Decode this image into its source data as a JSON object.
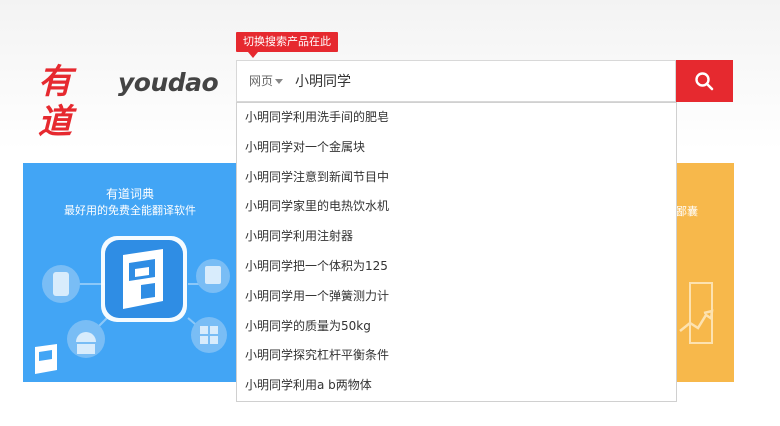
{
  "logo": {
    "cn": "有道",
    "en": "youdao"
  },
  "tooltip": "切换搜索产品在此",
  "search": {
    "scope_label": "网页",
    "query": "小明同学",
    "button_icon": "search-icon"
  },
  "suggestions": [
    "小明同学利用洗手间的肥皂",
    "小明同学对一个金属块",
    "小明同学注意到新闻节目中",
    "小明同学家里的电热饮水机",
    "小明同学利用注射器",
    "小明同学把一个体积为125",
    "小明同学用一个弹簧测力计",
    "小明同学的质量为50kg",
    "小明同学探究杠杆平衡条件",
    "小明同学利用a b两物体"
  ],
  "promo_blue": {
    "title": "有道词典",
    "subtitle": "最好用的免费全能翻译软件",
    "color": "#42a5f5"
  },
  "promo_orange": {
    "text": "鄙囊",
    "color": "#f7b84b"
  },
  "colors": {
    "accent": "#e6292f"
  }
}
